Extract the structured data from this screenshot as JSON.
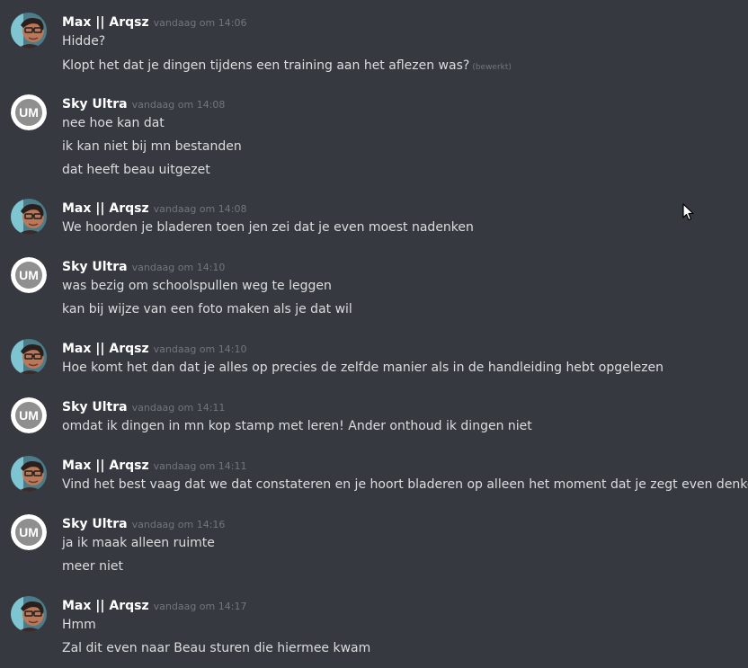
{
  "messages": [
    {
      "author": "Max || Arqsz",
      "avatar": "max-avatar",
      "timestamp": "vandaag om 14:06",
      "lines": [
        {
          "text": "Hidde?"
        },
        {
          "text": "Klopt het dat je dingen tijdens een training aan het aflezen was?",
          "edited": "(bewerkt)"
        }
      ]
    },
    {
      "author": "Sky Ultra",
      "avatar": "um-logo-avatar",
      "timestamp": "vandaag om 14:08",
      "lines": [
        {
          "text": "nee hoe kan dat"
        },
        {
          "text": "ik kan niet bij mn bestanden"
        },
        {
          "text": "dat heeft beau uitgezet"
        }
      ]
    },
    {
      "author": "Max || Arqsz",
      "avatar": "max-avatar",
      "timestamp": "vandaag om 14:08",
      "lines": [
        {
          "text": "We hoorden je bladeren toen jen zei dat je even moest nadenken"
        }
      ]
    },
    {
      "author": "Sky Ultra",
      "avatar": "um-logo-avatar",
      "timestamp": "vandaag om 14:10",
      "lines": [
        {
          "text": "was bezig om schoolspullen weg te leggen"
        },
        {
          "text": "kan bij wijze van een foto maken als je dat wil"
        }
      ]
    },
    {
      "author": "Max || Arqsz",
      "avatar": "max-avatar",
      "timestamp": "vandaag om 14:10",
      "lines": [
        {
          "text": "Hoe komt het dan dat je alles op precies de zelfde manier als in de handleiding hebt opgelezen"
        }
      ]
    },
    {
      "author": "Sky Ultra",
      "avatar": "um-logo-avatar",
      "timestamp": "vandaag om 14:11",
      "lines": [
        {
          "text": "omdat ik dingen in mn kop stamp met leren! Ander onthoud ik dingen niet"
        }
      ]
    },
    {
      "author": "Max || Arqsz",
      "avatar": "max-avatar",
      "timestamp": "vandaag om 14:11",
      "lines": [
        {
          "text": "Vind het best vaag dat we dat constateren en je hoort bladeren op alleen het moment dat je zegt even denken"
        }
      ]
    },
    {
      "author": "Sky Ultra",
      "avatar": "um-logo-avatar",
      "timestamp": "vandaag om 14:16",
      "lines": [
        {
          "text": "ja ik maak alleen ruimte"
        },
        {
          "text": "meer niet"
        }
      ]
    },
    {
      "author": "Max || Arqsz",
      "avatar": "max-avatar",
      "timestamp": "vandaag om 14:17",
      "lines": [
        {
          "text": "Hmm"
        },
        {
          "text": "Zal dit even naar Beau sturen die hiermee kwam"
        }
      ]
    }
  ],
  "colors": {
    "background": "#36393f",
    "username": "#ffffff",
    "message_text": "#dcddde",
    "timestamp": "#72767d"
  }
}
